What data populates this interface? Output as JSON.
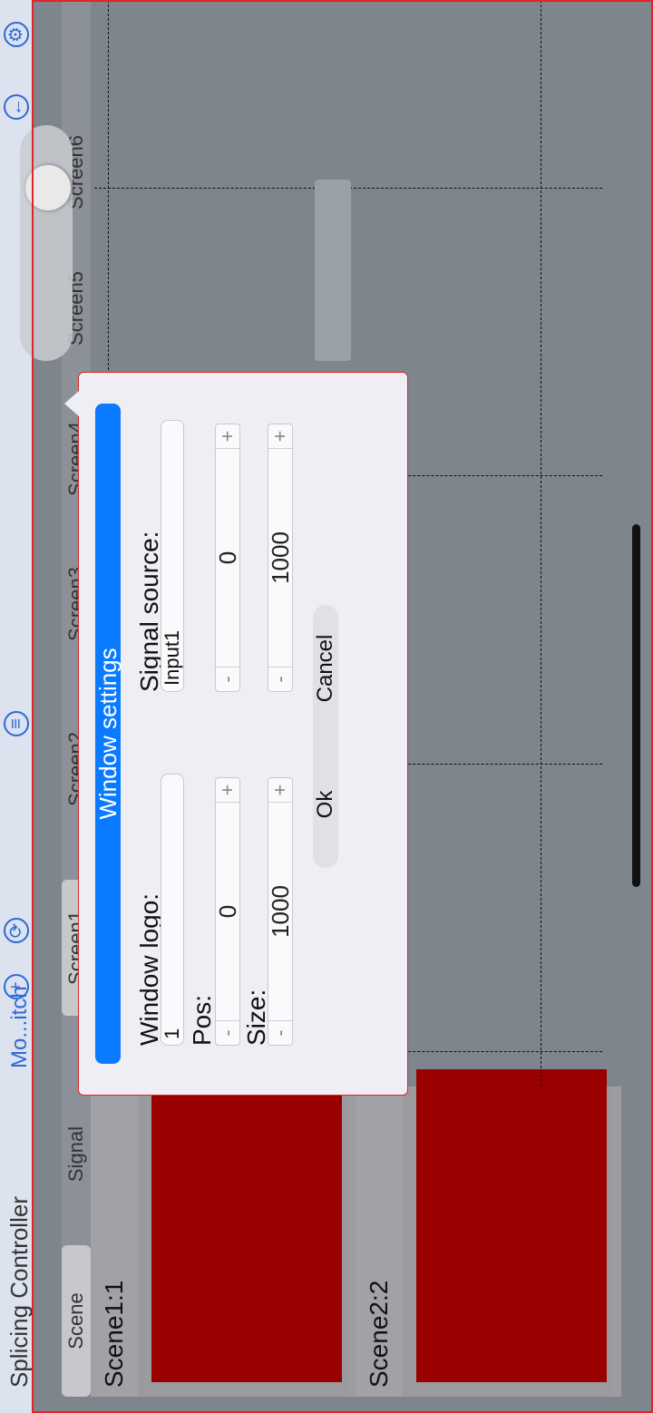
{
  "app": {
    "title": "Splicing Controller",
    "mode_link": "Mo...itch"
  },
  "toolbar": {
    "icons": [
      "add-icon",
      "refresh-icon",
      "menu-icon",
      "back-icon",
      "settings-icon"
    ]
  },
  "tabs": {
    "scene_label": "Scene",
    "signal_label": "Signal"
  },
  "scenes": [
    {
      "label": "Scene1:1"
    },
    {
      "label": "Scene2:2"
    }
  ],
  "screens": [
    "Screen1",
    "Screen2",
    "Screen3",
    "Screen4",
    "Screen5",
    "Screen6"
  ],
  "dialog": {
    "title": "Window settings",
    "window_logo_label": "Window logo:",
    "window_logo_value": "1",
    "signal_source_label": "Signal source:",
    "signal_source_value": "Input1",
    "pos_label": "Pos:",
    "pos_x": "0",
    "pos_y": "0",
    "size_label": "Size:",
    "size_w": "1000",
    "size_h": "1000",
    "ok_label": "Ok",
    "cancel_label": "Cancel",
    "minus": "-",
    "plus": "+"
  },
  "colors": {
    "accent": "#0a7bff",
    "scene_thumb": "#9b0000",
    "link": "#2e6ad6",
    "frame": "#e0242a"
  }
}
